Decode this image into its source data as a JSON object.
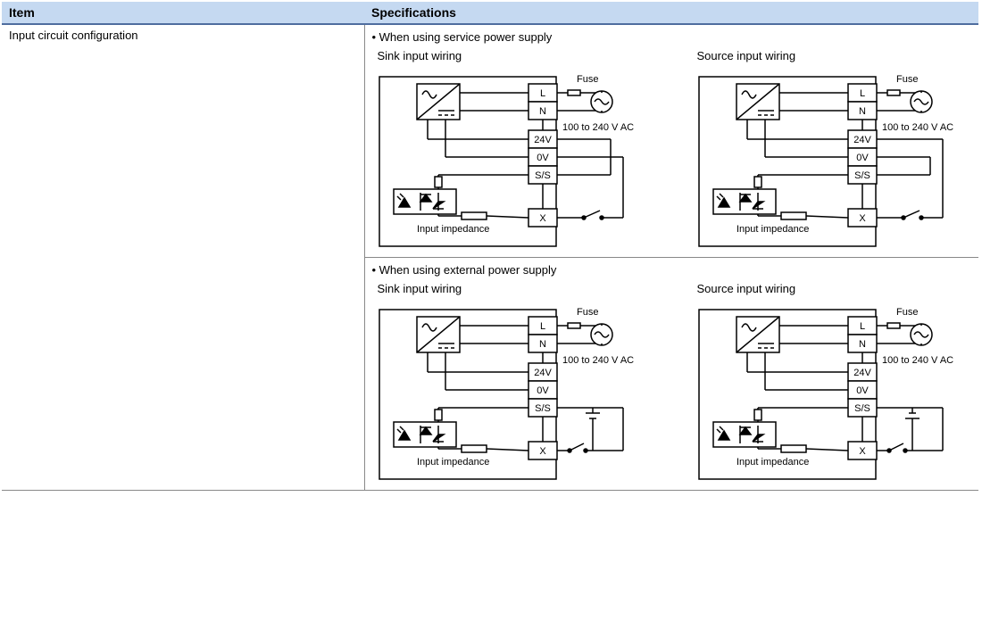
{
  "header": {
    "item": "Item",
    "spec": "Specifications"
  },
  "row_label": "Input circuit configuration",
  "sections": [
    {
      "bullet": "• When using service power supply"
    },
    {
      "bullet": "• When using external power supply"
    }
  ],
  "diag": {
    "sink_title": "Sink input wiring",
    "source_title": "Source input wiring",
    "labels": {
      "fuse": "Fuse",
      "ac_range": "100 to 240 V AC",
      "L": "L",
      "N": "N",
      "V24": "24V",
      "V0": "0V",
      "SS": "S/S",
      "X": "X",
      "imp": "Input impedance"
    }
  }
}
